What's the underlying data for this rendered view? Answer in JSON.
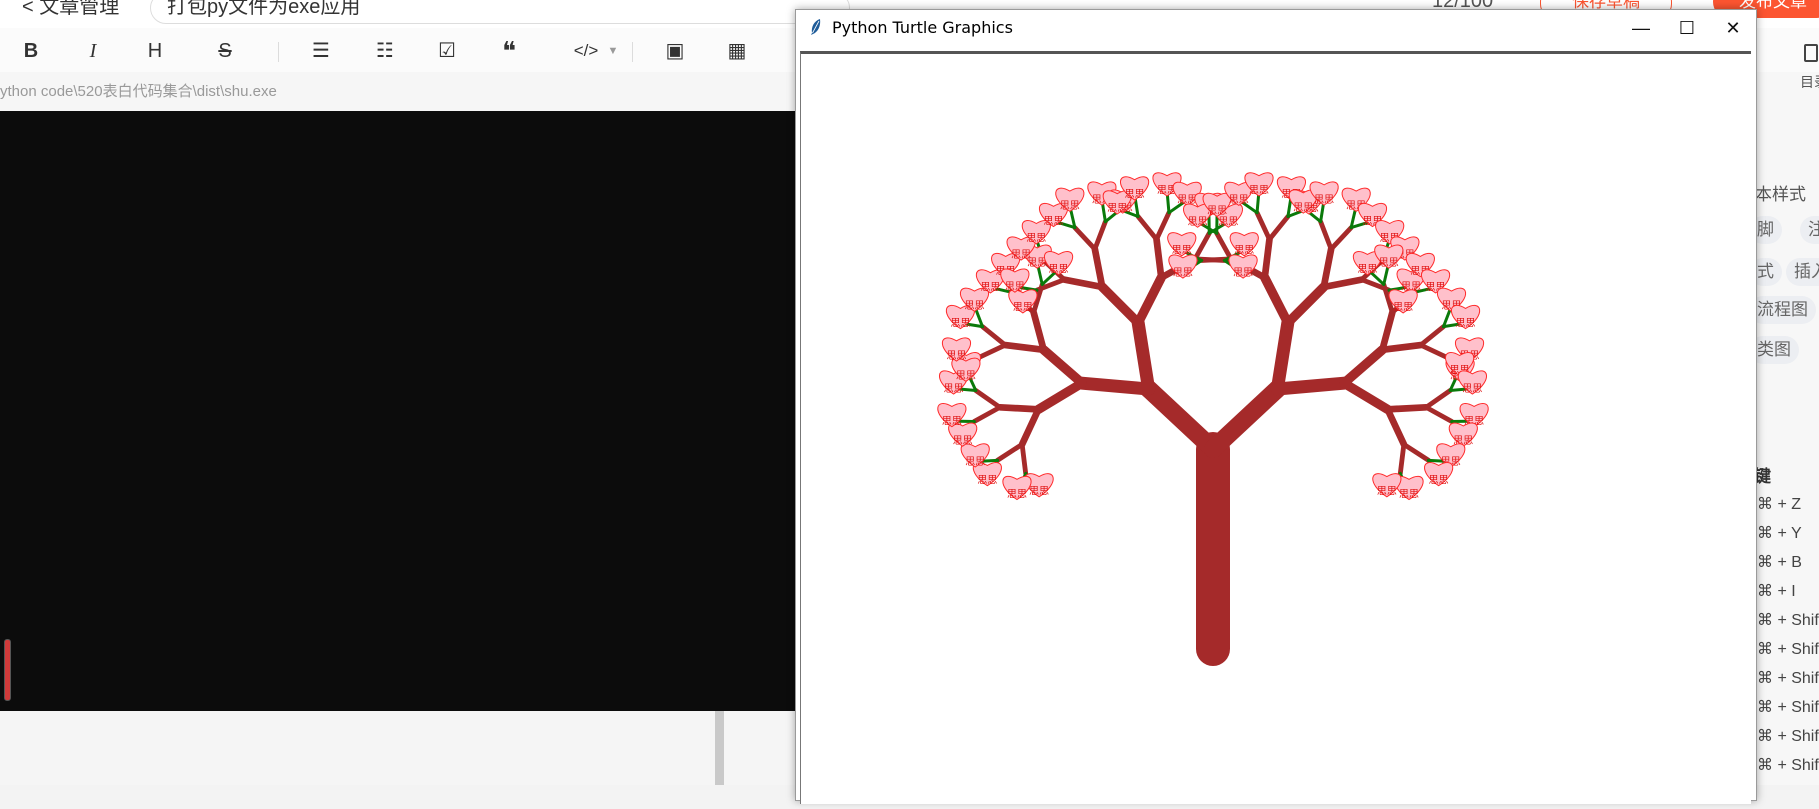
{
  "editor": {
    "back_label": "< 文章管理",
    "title_value": "打包py文件为exe应用",
    "counter": "12/100",
    "save_draft_label": "保存草稿",
    "publish_label": "发布文章",
    "file_path": "ython code\\520表白代码集合\\dist\\shu.exe"
  },
  "toolbar": {
    "items": [
      {
        "name": "bold",
        "glyph": "B"
      },
      {
        "name": "italic",
        "glyph": "I"
      },
      {
        "name": "heading",
        "glyph": "H"
      },
      {
        "name": "strikethrough",
        "glyph": "S"
      },
      {
        "name": "bullet-list",
        "glyph": "☰"
      },
      {
        "name": "numbered-list",
        "glyph": "☷"
      },
      {
        "name": "task-list",
        "glyph": "☑"
      },
      {
        "name": "quote",
        "glyph": "❝"
      },
      {
        "name": "code",
        "glyph": "</>"
      },
      {
        "name": "image",
        "glyph": "▣"
      },
      {
        "name": "video",
        "glyph": "▦"
      }
    ]
  },
  "right_panel": {
    "toc_label": "目录",
    "style_label": "本样式",
    "pills": [
      "脚",
      "注",
      "式",
      "插入",
      "流程图",
      "类图"
    ],
    "shortcuts_header": "键",
    "shortcuts": [
      "⌘ + Z",
      "⌘ + Y",
      "⌘ + B",
      "⌘ + I",
      "⌘ + Shift",
      "⌘ + Shift",
      "⌘ + Shift",
      "⌘ + Shift",
      "⌘ + Shift",
      "⌘ + Shift"
    ]
  },
  "turtle_window": {
    "title": "Python Turtle Graphics",
    "minimize": "—",
    "maximize": "☐",
    "close": "✕",
    "heart_text": "思思",
    "colors": {
      "trunk": "#a52a2a",
      "leaf": "#0a7a0a",
      "heart_fill": "#ffc0cb",
      "heart_stroke": "#ff2a2a"
    }
  }
}
